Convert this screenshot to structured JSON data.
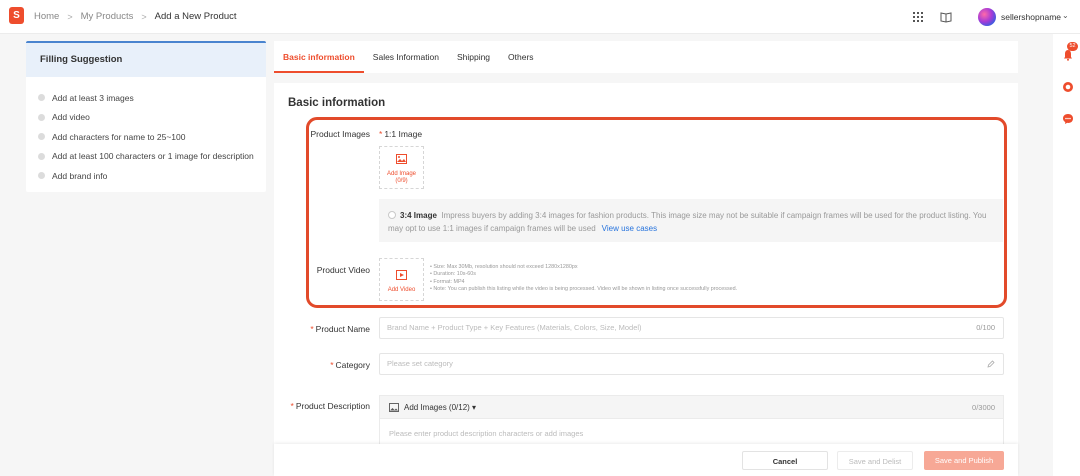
{
  "breadcrumb": {
    "home": "Home",
    "products": "My Products",
    "current": "Add a New Product"
  },
  "user": {
    "name": "sellershopname"
  },
  "filling_suggestion": {
    "title": "Filling Suggestion",
    "items": [
      "Add at least 3 images",
      "Add video",
      "Add characters for name to 25~100",
      "Add at least 100 characters or 1 image for description",
      "Add brand info"
    ]
  },
  "tabs": [
    "Basic information",
    "Sales Information",
    "Shipping",
    "Others"
  ],
  "basic_info": {
    "title": "Basic information",
    "product_images_label": "Product Images",
    "image_ratio": "1:1 Image",
    "add_image_label": "Add Image",
    "add_image_count": "(0/9)",
    "notice_title": "3:4 Image",
    "notice_text": "Impress buyers by adding 3:4 images for fashion products. This image size may not be suitable if campaign frames will be used for the product listing. You may opt to use 1:1 images if campaign frames will be used",
    "notice_link": "View use cases",
    "product_video_label": "Product Video",
    "add_video_label": "Add Video",
    "video_notes": [
      "Size: Max 30Mb, resolution should not exceed 1280x1280px",
      "Duration: 10s-60s",
      "Format: MP4",
      "Note: You can publish this listing while the video is being processed. Video will be shown in listing once successfully processed."
    ],
    "product_name_label": "Product Name",
    "product_name_placeholder": "Brand Name + Product Type + Key Features (Materials, Colors, Size, Model)",
    "product_name_count": "0/100",
    "category_label": "Category",
    "category_placeholder": "Please set category",
    "description_label": "Product Description",
    "add_images_label": "Add Images (0/12)",
    "description_count": "0/3000",
    "description_placeholder": "Please enter product description characters or add images"
  },
  "actions": {
    "cancel": "Cancel",
    "save_delist": "Save and Delist",
    "save_publish": "Save and Publish"
  },
  "notifications": {
    "count": "52"
  },
  "colors": {
    "accent": "#ee4d2d",
    "highlight": "#e24a2a",
    "link": "#2673dd"
  }
}
